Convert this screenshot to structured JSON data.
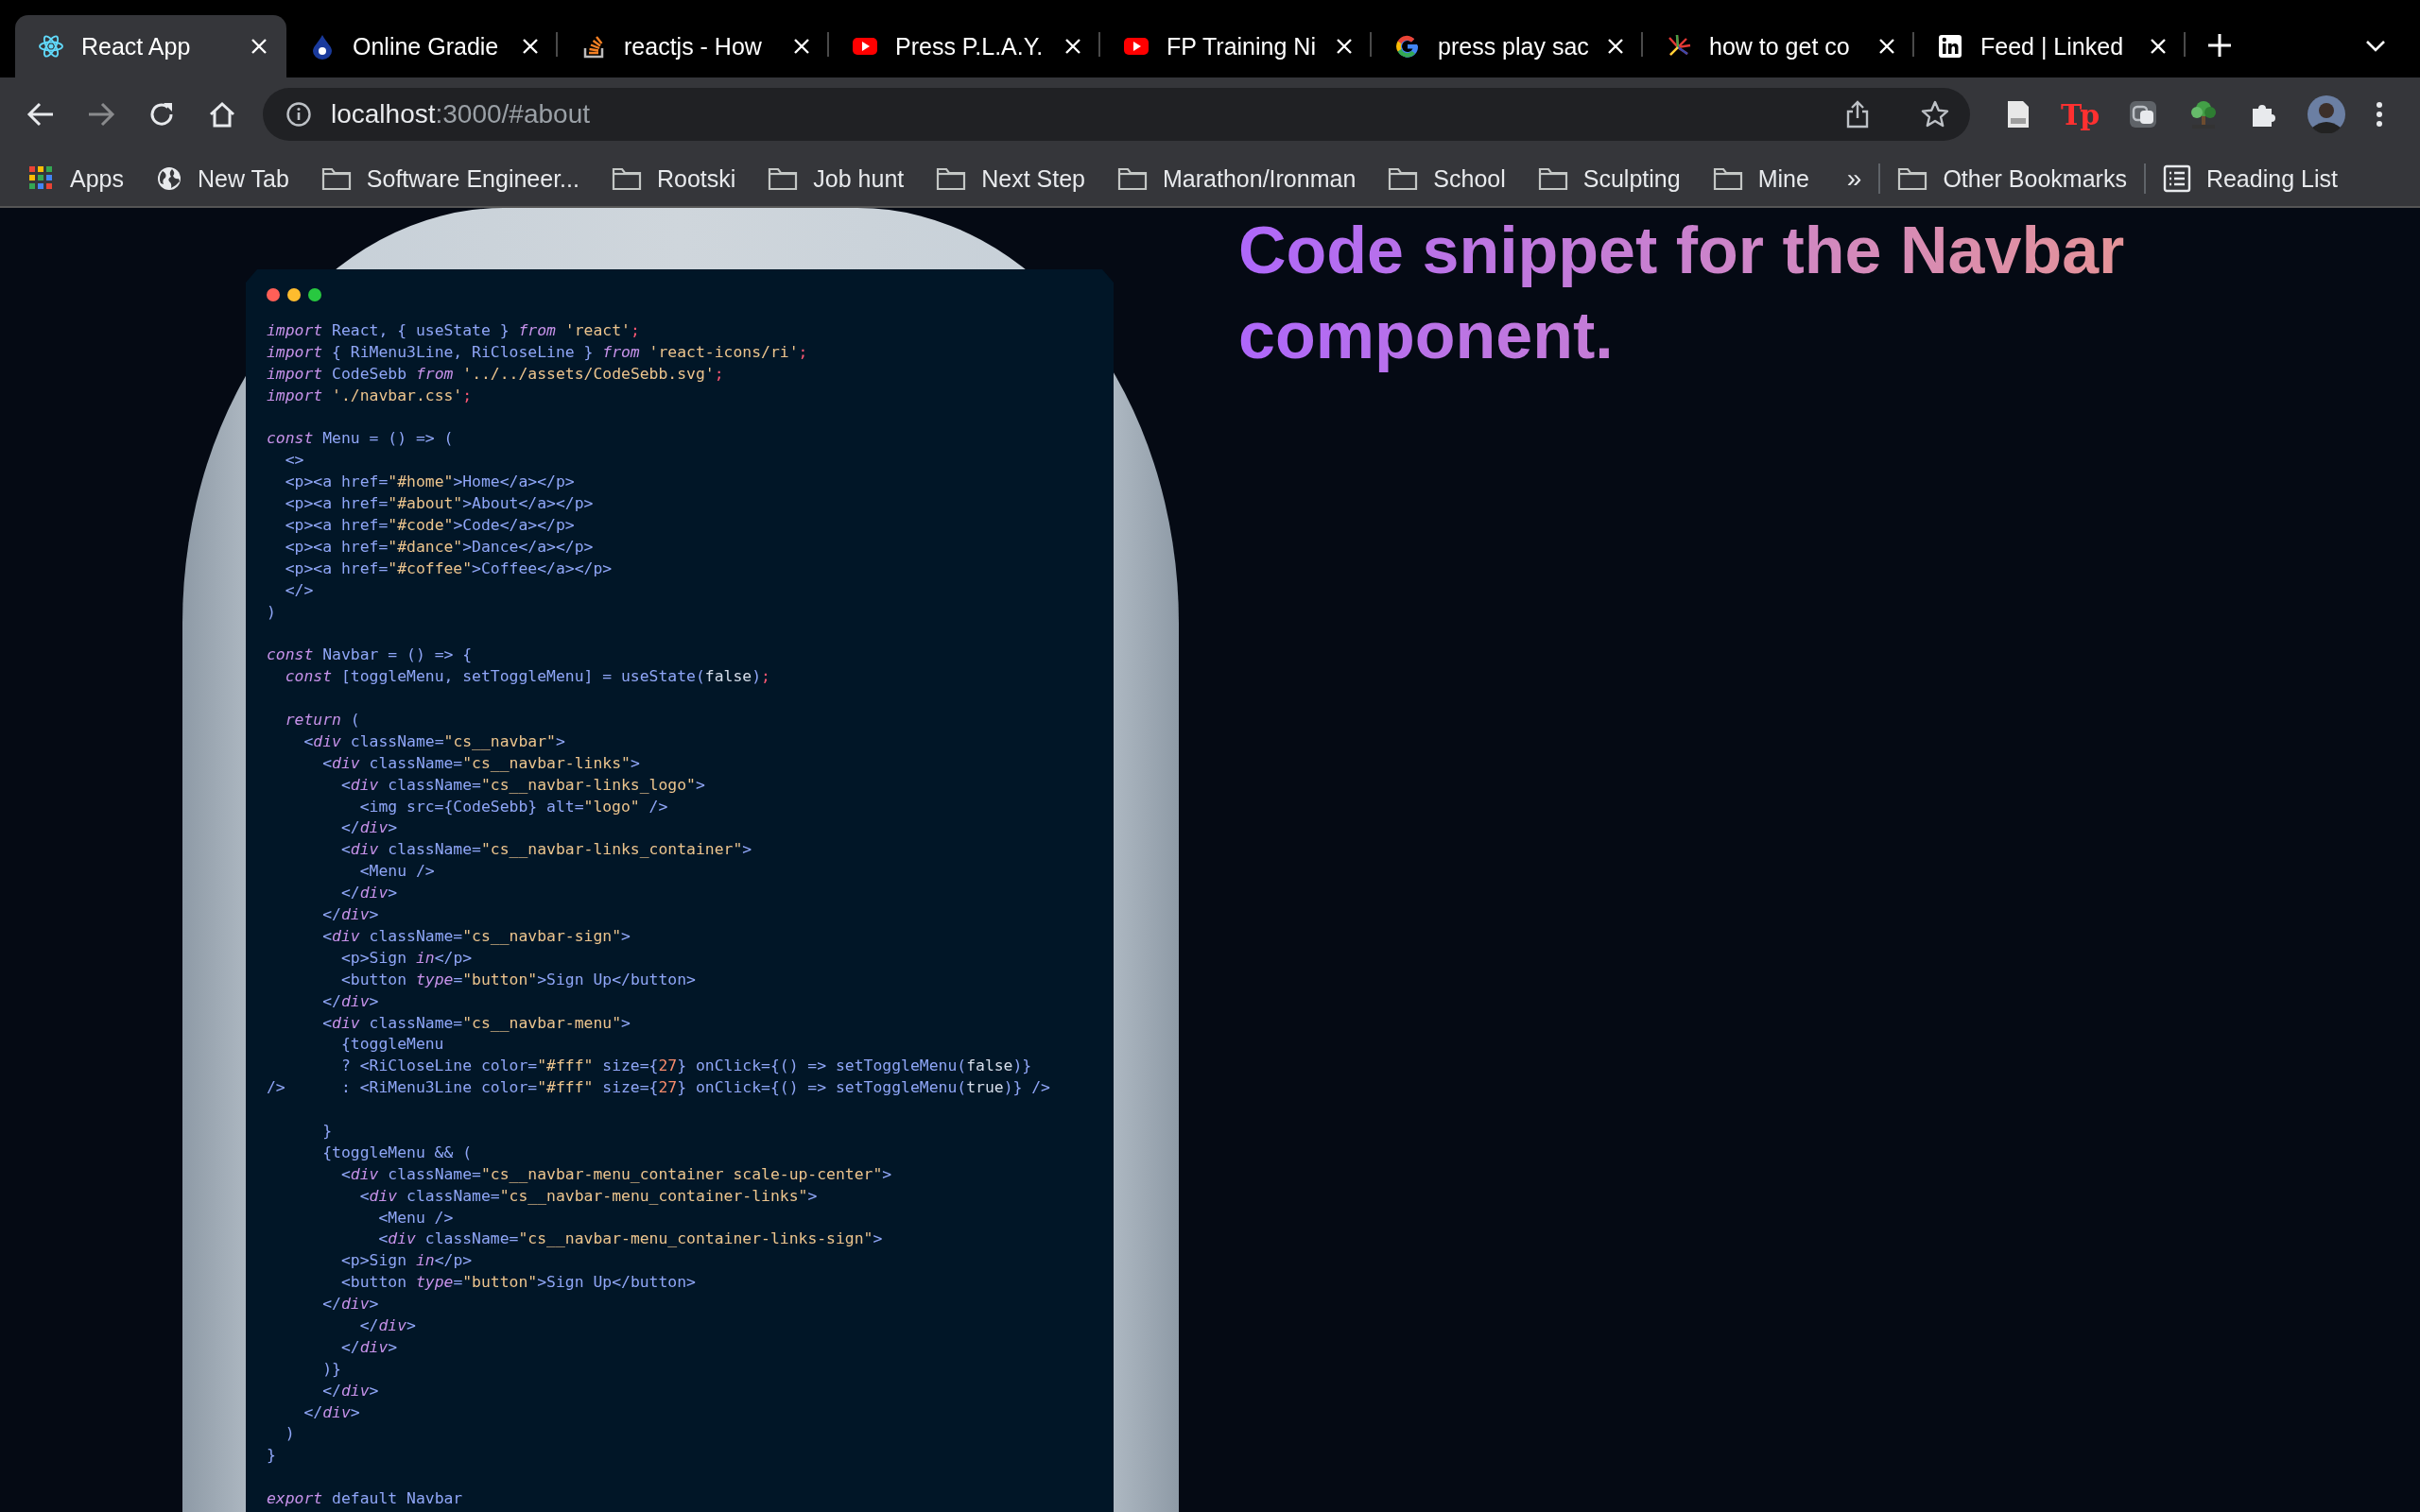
{
  "tabs": [
    {
      "title": "React App",
      "selected": true
    },
    {
      "title": "Online Gradie",
      "selected": false
    },
    {
      "title": "reactjs - How",
      "selected": false
    },
    {
      "title": "Press P.L.A.Y.",
      "selected": false
    },
    {
      "title": "FP Training Ni",
      "selected": false
    },
    {
      "title": "press play sac",
      "selected": false
    },
    {
      "title": "how to get co",
      "selected": false
    },
    {
      "title": "Feed | Linked",
      "selected": false
    }
  ],
  "toolbar": {
    "url_host": "localhost",
    "url_path": ":3000/#about",
    "extension_label": "Tp"
  },
  "bookmarks": [
    {
      "label": "Apps",
      "kind": "apps"
    },
    {
      "label": "New Tab",
      "kind": "site"
    },
    {
      "label": "Software Engineer...",
      "kind": "folder"
    },
    {
      "label": "Rootski",
      "kind": "folder"
    },
    {
      "label": "Job hunt",
      "kind": "folder"
    },
    {
      "label": "Next Step",
      "kind": "folder"
    },
    {
      "label": "Marathon/Ironman",
      "kind": "folder"
    },
    {
      "label": "School",
      "kind": "folder"
    },
    {
      "label": "Sculpting",
      "kind": "folder"
    },
    {
      "label": "Mine",
      "kind": "folder"
    }
  ],
  "bookmarks_overflow": "»",
  "other_bookmarks": "Other Bookmarks",
  "reading_list": "Reading List",
  "heading": "Code snippet for the Navbar component.",
  "code_blocks": [
    [
      [
        {
          "kind": "keyword",
          "text": "import"
        },
        {
          "kind": "plain",
          "text": " React, { useState } "
        },
        {
          "kind": "keyword",
          "text": "from"
        },
        {
          "kind": "string",
          "text": " 'react'"
        },
        {
          "kind": "punct",
          "text": ";"
        }
      ],
      [
        {
          "kind": "keyword",
          "text": "import"
        },
        {
          "kind": "plain",
          "text": " { RiMenu3Line, RiCloseLine } "
        },
        {
          "kind": "keyword",
          "text": "from"
        },
        {
          "kind": "string",
          "text": " 'react-icons/ri'"
        },
        {
          "kind": "punct",
          "text": ";"
        }
      ],
      [
        {
          "kind": "keyword",
          "text": "import"
        },
        {
          "kind": "plain",
          "text": " CodeSebb "
        },
        {
          "kind": "keyword",
          "text": "from"
        },
        {
          "kind": "string",
          "text": " '../../assets/CodeSebb.svg'"
        },
        {
          "kind": "punct",
          "text": ";"
        }
      ],
      [
        {
          "kind": "keyword",
          "text": "import"
        },
        {
          "kind": "string",
          "text": " './navbar.css'"
        },
        {
          "kind": "punct",
          "text": ";"
        }
      ]
    ],
    [
      [
        {
          "kind": "keyword",
          "text": "const"
        },
        {
          "kind": "plain",
          "text": " Menu = () => ("
        }
      ],
      [
        {
          "kind": "plain",
          "text": "  <>"
        }
      ],
      [
        {
          "kind": "plain",
          "text": "  <p><a href="
        },
        {
          "kind": "string",
          "text": "\"#home\""
        },
        {
          "kind": "plain",
          "text": ">Home</a></p>"
        }
      ],
      [
        {
          "kind": "plain",
          "text": "  <p><a href="
        },
        {
          "kind": "string",
          "text": "\"#about\""
        },
        {
          "kind": "plain",
          "text": ">About</a></p>"
        }
      ],
      [
        {
          "kind": "plain",
          "text": "  <p><a href="
        },
        {
          "kind": "string",
          "text": "\"#code\""
        },
        {
          "kind": "plain",
          "text": ">Code</a></p>"
        }
      ],
      [
        {
          "kind": "plain",
          "text": "  <p><a href="
        },
        {
          "kind": "string",
          "text": "\"#dance\""
        },
        {
          "kind": "plain",
          "text": ">Dance</a></p>"
        }
      ],
      [
        {
          "kind": "plain",
          "text": "  <p><a href="
        },
        {
          "kind": "string",
          "text": "\"#coffee\""
        },
        {
          "kind": "plain",
          "text": ">Coffee</a></p>"
        }
      ],
      [
        {
          "kind": "plain",
          "text": "  </>"
        }
      ],
      [
        {
          "kind": "plain",
          "text": ")"
        }
      ]
    ],
    [
      [
        {
          "kind": "keyword",
          "text": "const"
        },
        {
          "kind": "plain",
          "text": " Navbar = () => {"
        }
      ],
      [
        {
          "kind": "keyword",
          "text": "  const"
        },
        {
          "kind": "plain",
          "text": " [toggleMenu, setToggleMenu] = useState("
        },
        {
          "kind": "value",
          "text": "false"
        },
        {
          "kind": "plain",
          "text": ")"
        },
        {
          "kind": "punct",
          "text": ";"
        }
      ]
    ],
    [
      [
        {
          "kind": "keyword",
          "text": "  return"
        },
        {
          "kind": "plain",
          "text": " ("
        }
      ],
      [
        {
          "kind": "plain",
          "text": "    <"
        },
        {
          "kind": "keyword",
          "text": "div"
        },
        {
          "kind": "plain",
          "text": " className="
        },
        {
          "kind": "string",
          "text": "\"cs__navbar\""
        },
        {
          "kind": "plain",
          "text": ">"
        }
      ],
      [
        {
          "kind": "plain",
          "text": "      <"
        },
        {
          "kind": "keyword",
          "text": "div"
        },
        {
          "kind": "plain",
          "text": " className="
        },
        {
          "kind": "string",
          "text": "\"cs__navbar-links\""
        },
        {
          "kind": "plain",
          "text": ">"
        }
      ],
      [
        {
          "kind": "plain",
          "text": "        <"
        },
        {
          "kind": "keyword",
          "text": "div"
        },
        {
          "kind": "plain",
          "text": " className="
        },
        {
          "kind": "string",
          "text": "\"cs__navbar-links_logo\""
        },
        {
          "kind": "plain",
          "text": ">"
        }
      ],
      [
        {
          "kind": "plain",
          "text": "          <img src={CodeSebb} alt="
        },
        {
          "kind": "string",
          "text": "\"logo\""
        },
        {
          "kind": "plain",
          "text": " />"
        }
      ],
      [
        {
          "kind": "plain",
          "text": "        </"
        },
        {
          "kind": "keyword",
          "text": "div"
        },
        {
          "kind": "plain",
          "text": ">"
        }
      ],
      [
        {
          "kind": "plain",
          "text": "        <"
        },
        {
          "kind": "keyword",
          "text": "div"
        },
        {
          "kind": "plain",
          "text": " className="
        },
        {
          "kind": "string",
          "text": "\"cs__navbar-links_container\""
        },
        {
          "kind": "plain",
          "text": ">"
        }
      ],
      [
        {
          "kind": "plain",
          "text": "          <Menu />"
        }
      ],
      [
        {
          "kind": "plain",
          "text": "        </"
        },
        {
          "kind": "keyword",
          "text": "div"
        },
        {
          "kind": "plain",
          "text": ">"
        }
      ],
      [
        {
          "kind": "plain",
          "text": "      </"
        },
        {
          "kind": "keyword",
          "text": "div"
        },
        {
          "kind": "plain",
          "text": ">"
        }
      ],
      [
        {
          "kind": "plain",
          "text": "      <"
        },
        {
          "kind": "keyword",
          "text": "div"
        },
        {
          "kind": "plain",
          "text": " className="
        },
        {
          "kind": "string",
          "text": "\"cs__navbar-sign\""
        },
        {
          "kind": "plain",
          "text": ">"
        }
      ],
      [
        {
          "kind": "plain",
          "text": "        <p>Sign "
        },
        {
          "kind": "keyword",
          "text": "in"
        },
        {
          "kind": "plain",
          "text": "</p>"
        }
      ],
      [
        {
          "kind": "plain",
          "text": "        <button "
        },
        {
          "kind": "keyword",
          "text": "type"
        },
        {
          "kind": "plain",
          "text": "="
        },
        {
          "kind": "string",
          "text": "\"button\""
        },
        {
          "kind": "plain",
          "text": ">Sign Up</button>"
        }
      ],
      [
        {
          "kind": "plain",
          "text": "      </"
        },
        {
          "kind": "keyword",
          "text": "div"
        },
        {
          "kind": "plain",
          "text": ">"
        }
      ],
      [
        {
          "kind": "plain",
          "text": "      <"
        },
        {
          "kind": "keyword",
          "text": "div"
        },
        {
          "kind": "plain",
          "text": " className="
        },
        {
          "kind": "string",
          "text": "\"cs__navbar-menu\""
        },
        {
          "kind": "plain",
          "text": ">"
        }
      ],
      [
        {
          "kind": "plain",
          "text": "        {toggleMenu"
        }
      ],
      [
        {
          "kind": "plain",
          "text": "        ? <RiCloseLine color="
        },
        {
          "kind": "string",
          "text": "\"#fff\""
        },
        {
          "kind": "plain",
          "text": " size={"
        },
        {
          "kind": "number",
          "text": "27"
        },
        {
          "kind": "plain",
          "text": "} onClick={() => setToggleMenu("
        },
        {
          "kind": "value",
          "text": "false"
        },
        {
          "kind": "plain",
          "text": ")}"
        }
      ],
      [
        {
          "kind": "plain",
          "text": "/>      : <RiMenu3Line color="
        },
        {
          "kind": "string",
          "text": "\"#fff\""
        },
        {
          "kind": "plain",
          "text": " size={"
        },
        {
          "kind": "number",
          "text": "27"
        },
        {
          "kind": "plain",
          "text": "} onClick={() => setToggleMenu("
        },
        {
          "kind": "value",
          "text": "true"
        },
        {
          "kind": "plain",
          "text": ")} />"
        }
      ]
    ],
    [
      [
        {
          "kind": "plain",
          "text": "      }"
        }
      ],
      [
        {
          "kind": "plain",
          "text": "      {toggleMenu && ("
        }
      ],
      [
        {
          "kind": "plain",
          "text": "        <"
        },
        {
          "kind": "keyword",
          "text": "div"
        },
        {
          "kind": "plain",
          "text": " className="
        },
        {
          "kind": "string",
          "text": "\"cs__navbar-menu_container scale-up-center\""
        },
        {
          "kind": "plain",
          "text": ">"
        }
      ],
      [
        {
          "kind": "plain",
          "text": "          <"
        },
        {
          "kind": "keyword",
          "text": "div"
        },
        {
          "kind": "plain",
          "text": " className="
        },
        {
          "kind": "string",
          "text": "\"cs__navbar-menu_container-links\""
        },
        {
          "kind": "plain",
          "text": ">"
        }
      ],
      [
        {
          "kind": "plain",
          "text": "            <Menu />"
        }
      ],
      [
        {
          "kind": "plain",
          "text": "            <"
        },
        {
          "kind": "keyword",
          "text": "div"
        },
        {
          "kind": "plain",
          "text": " className="
        },
        {
          "kind": "string",
          "text": "\"cs__navbar-menu_container-links-sign\""
        },
        {
          "kind": "plain",
          "text": ">"
        }
      ],
      [
        {
          "kind": "plain",
          "text": "        <p>Sign "
        },
        {
          "kind": "keyword",
          "text": "in"
        },
        {
          "kind": "plain",
          "text": "</p>"
        }
      ],
      [
        {
          "kind": "plain",
          "text": "        <button "
        },
        {
          "kind": "keyword",
          "text": "type"
        },
        {
          "kind": "plain",
          "text": "="
        },
        {
          "kind": "string",
          "text": "\"button\""
        },
        {
          "kind": "plain",
          "text": ">Sign Up</button>"
        }
      ],
      [
        {
          "kind": "plain",
          "text": "      </"
        },
        {
          "kind": "keyword",
          "text": "div"
        },
        {
          "kind": "plain",
          "text": ">"
        }
      ],
      [
        {
          "kind": "plain",
          "text": "          </"
        },
        {
          "kind": "keyword",
          "text": "div"
        },
        {
          "kind": "plain",
          "text": ">"
        }
      ],
      [
        {
          "kind": "plain",
          "text": "        </"
        },
        {
          "kind": "keyword",
          "text": "div"
        },
        {
          "kind": "plain",
          "text": ">"
        }
      ],
      [
        {
          "kind": "plain",
          "text": "      )}"
        }
      ],
      [
        {
          "kind": "plain",
          "text": "      </"
        },
        {
          "kind": "keyword",
          "text": "div"
        },
        {
          "kind": "plain",
          "text": ">"
        }
      ],
      [
        {
          "kind": "plain",
          "text": "    </"
        },
        {
          "kind": "keyword",
          "text": "div"
        },
        {
          "kind": "plain",
          "text": ">"
        }
      ],
      [
        {
          "kind": "plain",
          "text": "  )"
        }
      ],
      [
        {
          "kind": "plain",
          "text": "}"
        }
      ]
    ],
    [
      [
        {
          "kind": "keyword",
          "text": "export"
        },
        {
          "kind": "plain",
          "text": " default Navbar"
        }
      ]
    ]
  ]
}
